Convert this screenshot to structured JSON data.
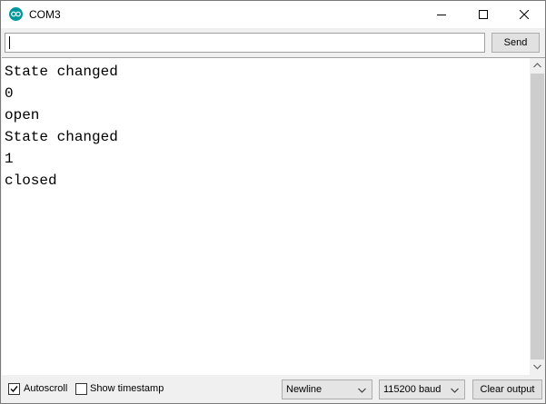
{
  "window": {
    "title": "COM3",
    "app_icon": "arduino-icon",
    "controls": [
      "minimize-icon",
      "maximize-icon",
      "close-icon"
    ]
  },
  "input": {
    "value": "",
    "send_label": "Send"
  },
  "output": {
    "lines": [
      "State changed",
      "0",
      "open",
      "State changed",
      "1",
      "closed"
    ]
  },
  "footer": {
    "autoscroll_label": "Autoscroll",
    "autoscroll_checked": true,
    "timestamp_label": "Show timestamp",
    "timestamp_checked": false,
    "line_ending": "Newline",
    "baud_rate": "115200 baud",
    "clear_label": "Clear output"
  },
  "colors": {
    "accent": "#00979c"
  }
}
